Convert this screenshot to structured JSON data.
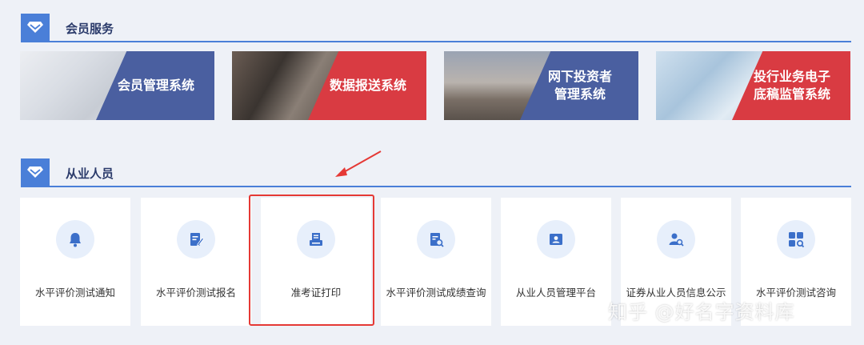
{
  "member_section": {
    "title": "会员服务",
    "icon": "diamond-icon",
    "banners": [
      {
        "label": "会员管理系统",
        "color": "#4a5fa0"
      },
      {
        "label": "数据报送系统",
        "color": "#d93b42"
      },
      {
        "label": "网下投资者\n管理系统",
        "color": "#4a5fa0"
      },
      {
        "label": "投行业务电子\n底稿监管系统",
        "color": "#d93b42"
      }
    ]
  },
  "staff_section": {
    "title": "从业人员",
    "icon": "diamond-icon",
    "cards": [
      {
        "label": "水平评价测试通知",
        "icon": "bell-icon"
      },
      {
        "label": "水平评价测试报名",
        "icon": "edit-form-icon"
      },
      {
        "label": "准考证打印",
        "icon": "printer-icon"
      },
      {
        "label": "水平评价测试成绩查询",
        "icon": "document-search-icon"
      },
      {
        "label": "从业人员管理平台",
        "icon": "id-card-icon"
      },
      {
        "label": "证券从业人员信息公示",
        "icon": "user-search-icon"
      },
      {
        "label": "水平评价测试咨询",
        "icon": "grid-search-icon"
      }
    ]
  },
  "watermark": "知乎 @好名字资料库",
  "colors": {
    "accent": "#4a7fd8",
    "highlight": "#e53935",
    "icon": "#3b6fc9"
  }
}
